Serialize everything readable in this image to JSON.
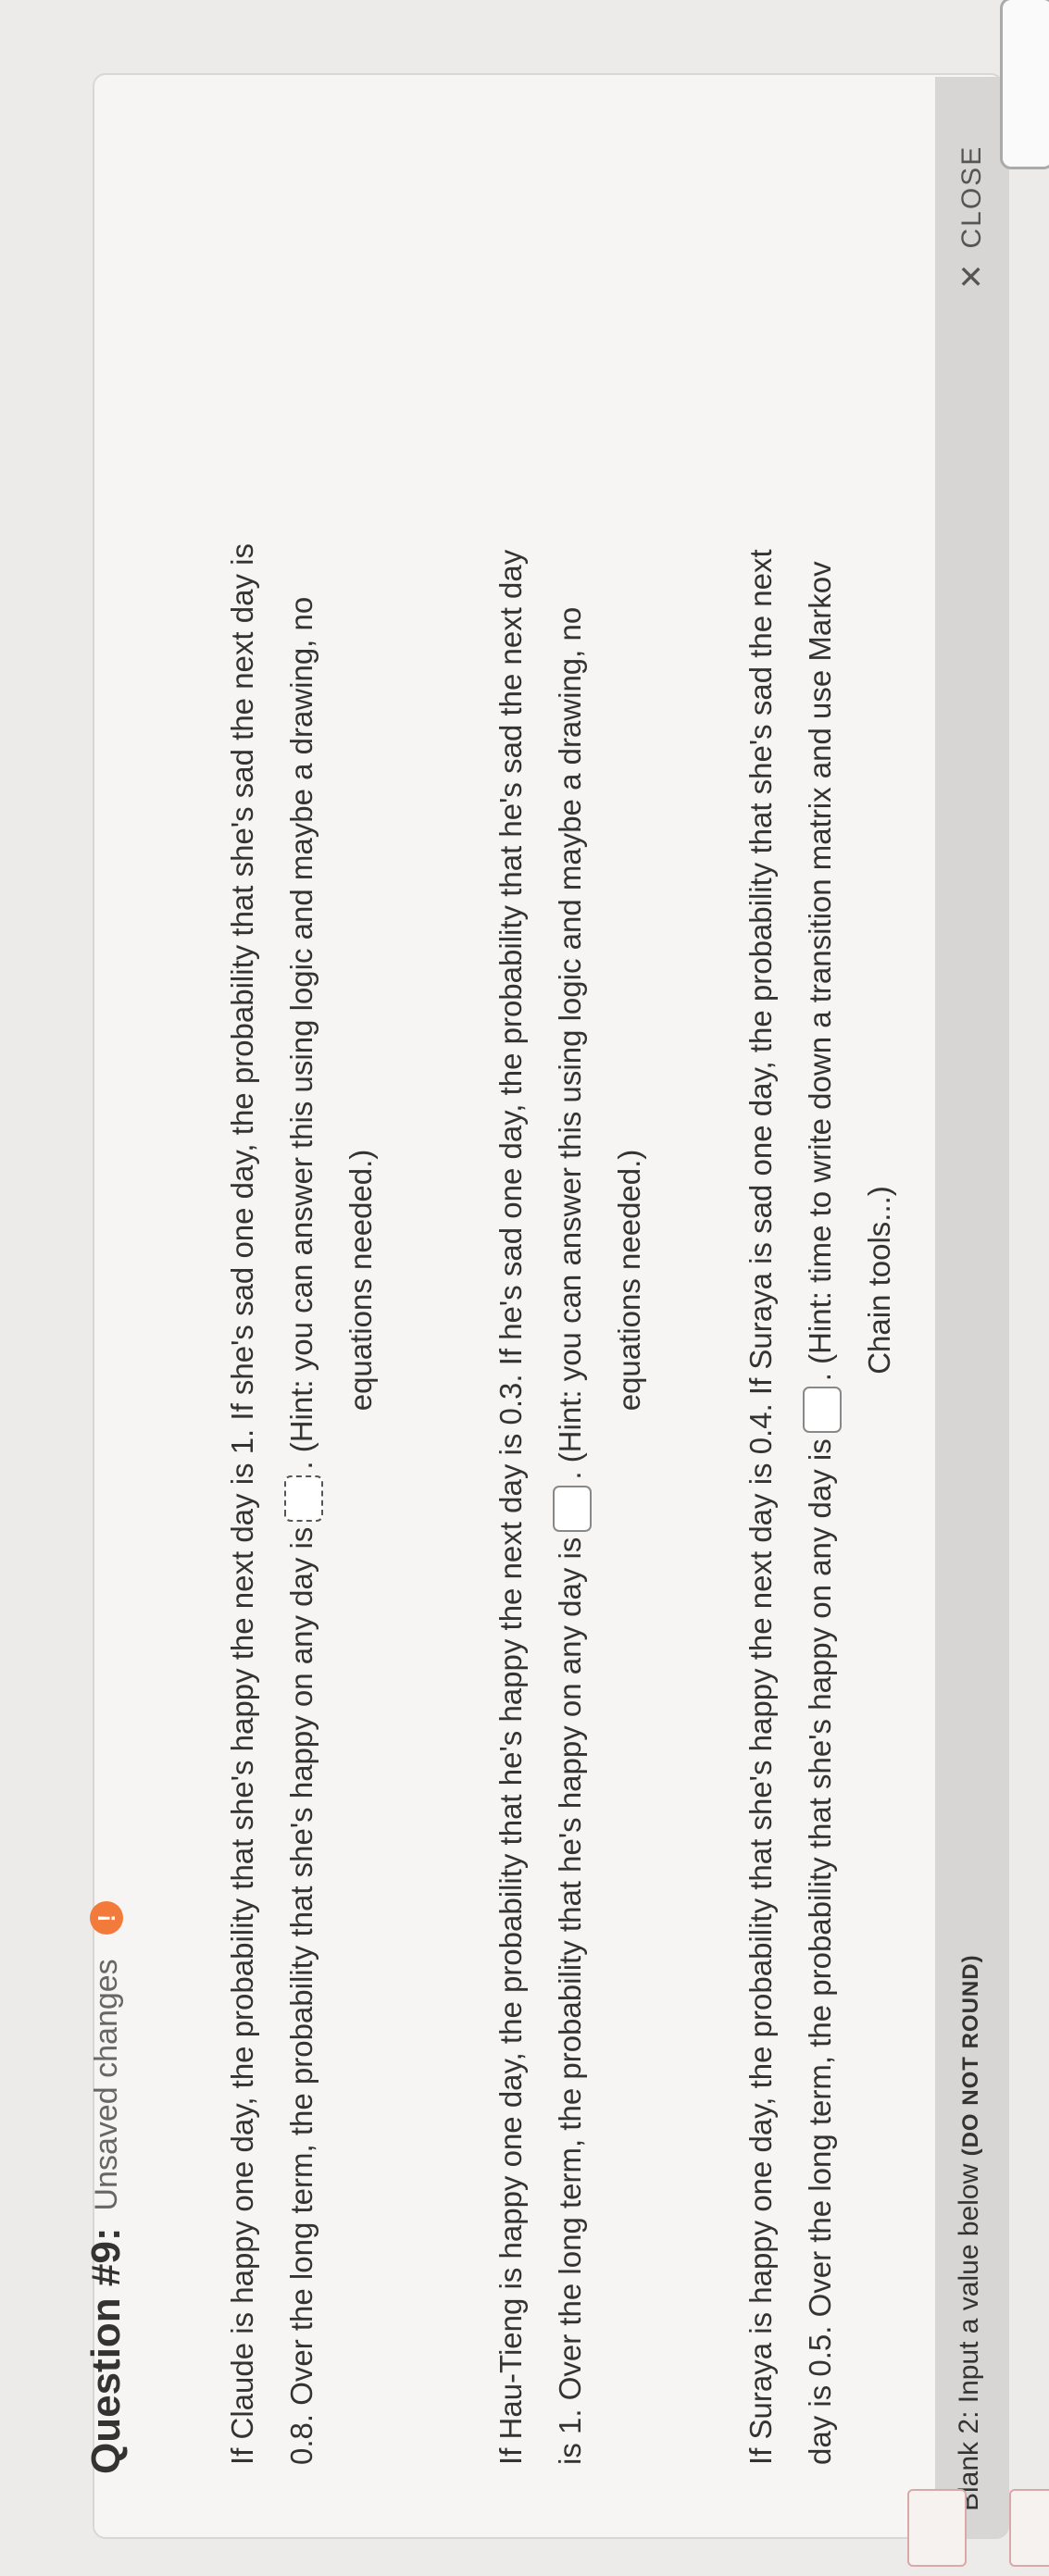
{
  "question": {
    "title": "Question #9:",
    "status": "Unsaved changes",
    "warning_icon": "!"
  },
  "paragraphs": {
    "p1": {
      "line1": "If Claude is happy one day, the probability that she's happy the next day is 1. If she's sad one day, the probability that she's sad the next day is",
      "line2_before": "0.8. Over the long term, the probability that she's happy on any day is",
      "line2_after": ". (Hint: you can answer this using logic and maybe a drawing, no",
      "line3": "equations needed.)"
    },
    "p2": {
      "line1": "If Hau-Tieng is happy one day, the probability that he's happy the next day is 0.3. If he's sad one day, the probability that he's sad the next day",
      "line2_before": "is 1. Over the long term, the probability that he's happy on any day is",
      "line2_after": ". (Hint: you can answer this using logic and maybe a drawing, no",
      "line3": "equations needed.)"
    },
    "p3": {
      "line1": "If Suraya is happy one day, the probability that she's happy the next day is 0.4. If Suraya is sad one day, the probability that she's sad the next",
      "line2_before": "day is 0.5. Over the long term, the probability that she's happy on any day is",
      "line2_after": ". (Hint: time to write down a transition matrix and use Markov",
      "line3": "Chain tools...)"
    }
  },
  "footer": {
    "blank_label": "Blank 2: Input a value below",
    "blank_note": "(DO NOT ROUND)",
    "close_label": "CLOSE",
    "close_icon": "✕"
  },
  "colors": {
    "warning": "#f27a3a",
    "background": "#f6f5f3"
  }
}
